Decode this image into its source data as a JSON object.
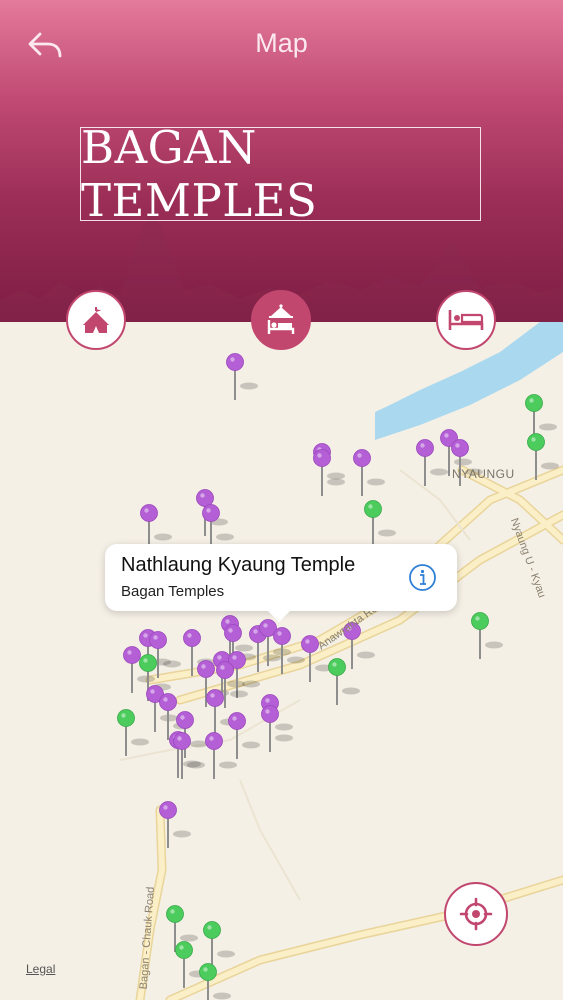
{
  "header": {
    "title": "Map",
    "banner_text": "BAGAN TEMPLES",
    "back_icon": "back-arrow-icon",
    "colors": {
      "primary": "#c2476f",
      "header_top": "#e47a9c",
      "header_bottom": "#7c1c43"
    }
  },
  "categories": [
    {
      "name": "attractions",
      "icon": "circus-tent-icon",
      "active": false
    },
    {
      "name": "hotels",
      "icon": "hotel-bell-bed-icon",
      "active": true
    },
    {
      "name": "lodging",
      "icon": "bed-icon",
      "active": false
    }
  ],
  "map": {
    "legal": "Legal",
    "labels": {
      "town": "NYAUNGU",
      "road_nyaung": "Nyaung U - Kyau",
      "road_anawrahta": "Anawrahta Road",
      "road_chauk": "Bagan - Chauk Road"
    },
    "colors": {
      "temple_pin": "#b55fd6",
      "hotel_pin": "#4ccc5c",
      "water": "#a9d8ef",
      "road": "#fae8b8"
    }
  },
  "callout": {
    "title": "Nathlaung Kyaung Temple",
    "subtitle": "Bagan Temples",
    "info_icon": "info-icon"
  },
  "locate_icon": "crosshair-location-icon"
}
